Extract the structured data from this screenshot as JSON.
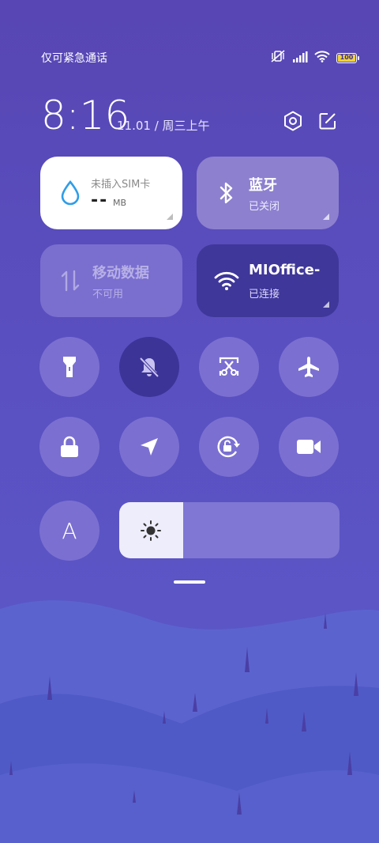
{
  "status_bar": {
    "carrier_text": "仅可紧急通话",
    "battery_level": "100",
    "icons": [
      "vibrate-mute-icon",
      "signal-icon",
      "wifi-icon",
      "battery-icon"
    ]
  },
  "header": {
    "time": "8:16",
    "date": "11.01 / 周三上午",
    "settings_icon": "settings-hex-icon",
    "edit_icon": "edit-icon"
  },
  "tiles": {
    "sim": {
      "label": "未插入SIM卡",
      "value": "--",
      "unit": "MB"
    },
    "bluetooth": {
      "label": "蓝牙",
      "status": "已关闭"
    },
    "mobile_data": {
      "label": "移动数据",
      "status": "不可用"
    },
    "wifi": {
      "label": "MIOffice-",
      "status": "已连接"
    }
  },
  "toggles_row1": [
    {
      "name": "flashlight",
      "active": false
    },
    {
      "name": "mute",
      "active": true
    },
    {
      "name": "screenshot",
      "active": false
    },
    {
      "name": "airplane-mode",
      "active": false
    }
  ],
  "toggles_row2": [
    {
      "name": "lock-screen",
      "active": false
    },
    {
      "name": "location",
      "active": false
    },
    {
      "name": "auto-rotate",
      "active": false
    },
    {
      "name": "screen-record",
      "active": false
    }
  ],
  "auto_brightness_label": "A",
  "brightness": {
    "level": 0.29
  },
  "colors": {
    "background": "#5746b3",
    "tile_active": "#3f3799",
    "tile_inactive": "#8d80cf",
    "toggle_inactive": "#7b70d1",
    "toggle_active": "#3c3497"
  }
}
